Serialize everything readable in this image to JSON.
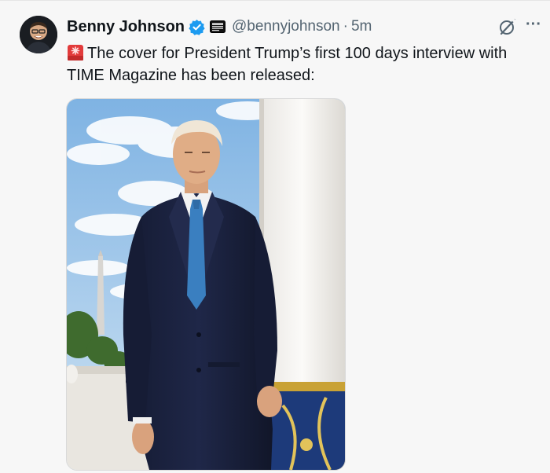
{
  "tweet": {
    "display_name": "Benny Johnson",
    "handle": "@bennyjohnson",
    "separator": "·",
    "time": "5m",
    "text": "The cover for President Trump’s first 100 days interview with TIME Magazine has been released:",
    "emoji_icon": "rotating-light-icon",
    "more_glyph": "···"
  },
  "colors": {
    "verified": "#1d9bf0",
    "secondary_text": "#536471",
    "primary_text": "#0f1419",
    "suit": "#1c2340",
    "tie": "#3a7fc0",
    "sky": "#9ec7ea"
  }
}
